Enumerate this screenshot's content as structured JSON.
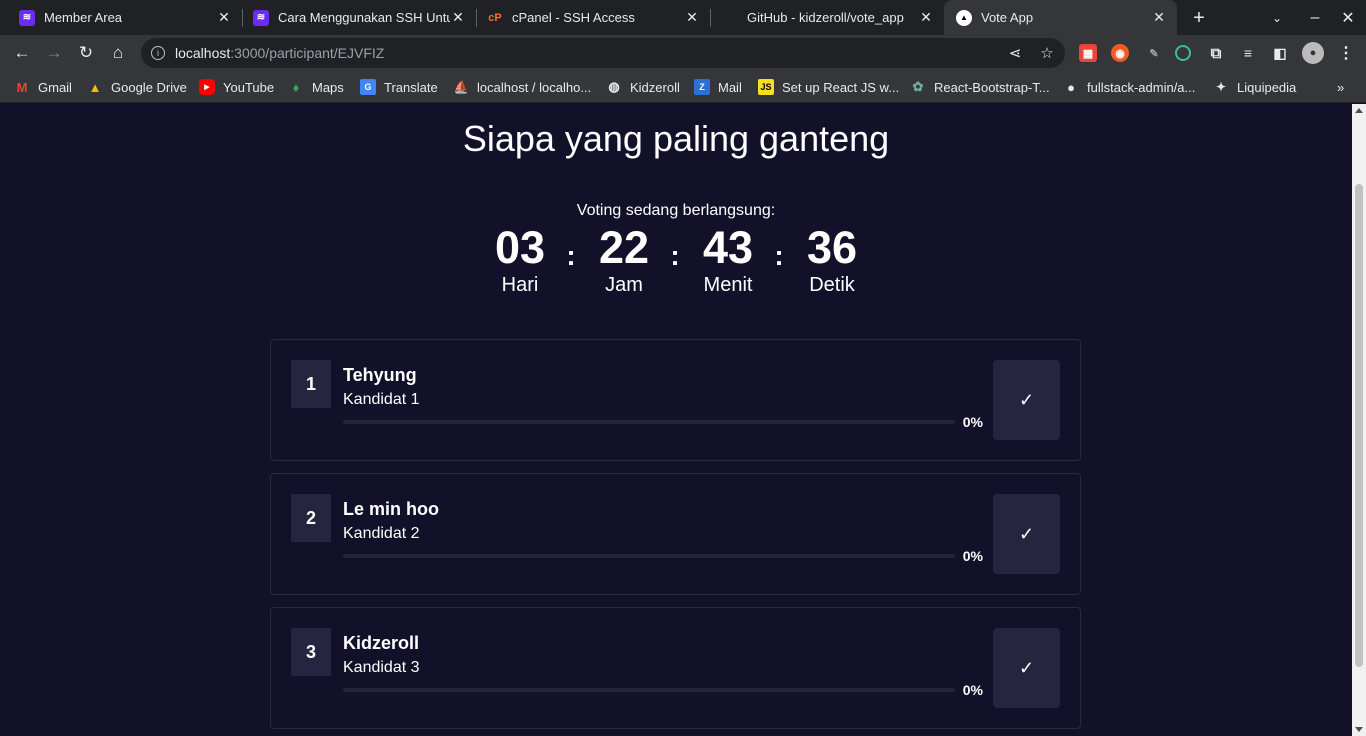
{
  "tabs": [
    {
      "title": "Member Area",
      "icon": "niagahoster-icon"
    },
    {
      "title": "Cara Menggunakan SSH Untuk",
      "icon": "niagahoster-icon"
    },
    {
      "title": "cPanel - SSH Access",
      "icon": "cpanel-icon"
    },
    {
      "title": "GitHub - kidzeroll/vote_app",
      "icon": "github-icon"
    },
    {
      "title": "Vote App",
      "icon": "vote-app-icon"
    }
  ],
  "address": {
    "host": "localhost",
    "path": ":3000/participant/EJVFIZ"
  },
  "bookmarks": [
    "Gmail",
    "Google Drive",
    "YouTube",
    "Maps",
    "Translate",
    "localhost / localho...",
    "Kidzeroll",
    "Mail",
    "Set up React JS w...",
    "React-Bootstrap-T...",
    "fullstack-admin/a...",
    "Liquipedia"
  ],
  "page": {
    "title": "Siapa yang paling ganteng",
    "voting_label": "Voting sedang berlangsung:",
    "countdown": [
      {
        "value": "03",
        "label": "Hari"
      },
      {
        "value": "22",
        "label": "Jam"
      },
      {
        "value": "43",
        "label": "Menit"
      },
      {
        "value": "36",
        "label": "Detik"
      }
    ],
    "separator": ":",
    "candidates": [
      {
        "rank": "1",
        "name": "Tehyung",
        "subtitle": "Kandidat 1",
        "percent_label": "0%",
        "percent": 0,
        "vote_symbol": "✓"
      },
      {
        "rank": "2",
        "name": "Le min hoo",
        "subtitle": "Kandidat 2",
        "percent_label": "0%",
        "percent": 0,
        "vote_symbol": "✓"
      },
      {
        "rank": "3",
        "name": "Kidzeroll",
        "subtitle": "Kandidat 3",
        "percent_label": "0%",
        "percent": 0,
        "vote_symbol": "✓"
      }
    ]
  },
  "colors": {
    "page_bg": "#13102a",
    "card_border": "#2a2740",
    "box_bg": "#262540",
    "accent": "#6b63ff"
  }
}
